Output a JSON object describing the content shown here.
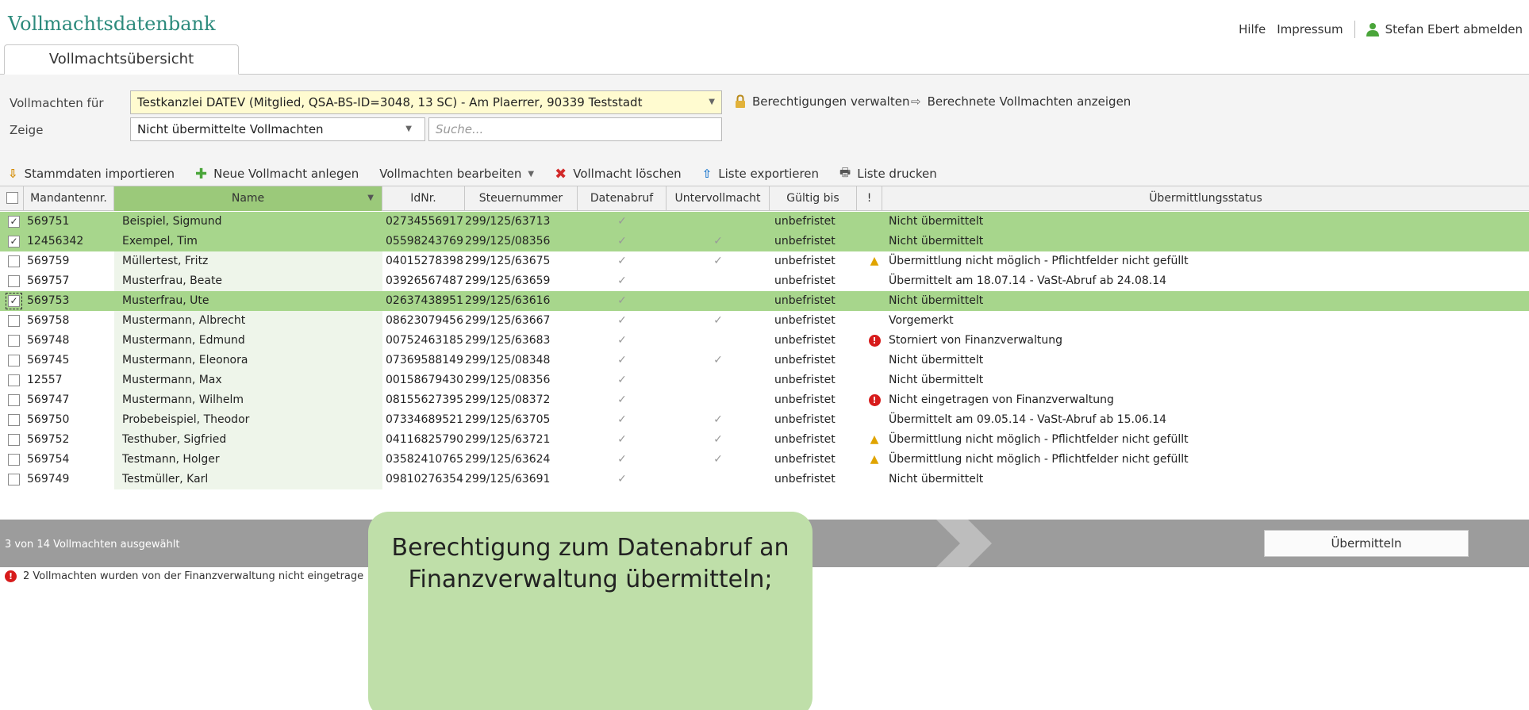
{
  "app": {
    "title": "Vollmachtsdatenbank"
  },
  "topnav": {
    "help": "Hilfe",
    "imprint": "Impressum",
    "logout": "Stefan Ebert abmelden"
  },
  "tabs": [
    {
      "label": "Vollmachtsübersicht"
    }
  ],
  "filters": {
    "vollmachten_label": "Vollmachten für",
    "vollmachten_value": "Testkanzlei DATEV (Mitglied, QSA-BS-ID=3048, 13 SC) - Am Plaerrer, 90339 Teststadt",
    "zeige_label": "Zeige",
    "zeige_value": "Nicht übermittelte Vollmachten",
    "search_placeholder": "Suche...",
    "permissions_link": "Berechtigungen verwalten",
    "computed_link": "Berechnete Vollmachten anzeigen"
  },
  "toolbar": {
    "import": "Stammdaten importieren",
    "new": "Neue Vollmacht anlegen",
    "edit": "Vollmachten bearbeiten",
    "delete": "Vollmacht löschen",
    "export": "Liste exportieren",
    "print": "Liste drucken"
  },
  "columns": [
    "Mandantennr.",
    "Name",
    "IdNr.",
    "Steuernummer",
    "Datenabruf",
    "Untervollmacht",
    "Gültig bis",
    "!",
    "Übermittlungsstatus"
  ],
  "rows": [
    {
      "nr": "569751",
      "name": "Beispiel, Sigmund",
      "idnr": "02734556917",
      "stnr": "299/125/63713",
      "abruf": "✓",
      "unter": "",
      "gueltig": "unbefristet",
      "flag": "",
      "status": "Nicht übermittelt",
      "selected": true
    },
    {
      "nr": "12456342",
      "name": "Exempel, Tim",
      "idnr": "05598243769",
      "stnr": "299/125/08356",
      "abruf": "✓",
      "unter": "✓",
      "gueltig": "unbefristet",
      "flag": "",
      "status": "Nicht übermittelt",
      "selected": true
    },
    {
      "nr": "569759",
      "name": "Müllertest, Fritz",
      "idnr": "04015278398",
      "stnr": "299/125/63675",
      "abruf": "✓",
      "unter": "✓",
      "gueltig": "unbefristet",
      "flag": "warning",
      "status": "Übermittlung nicht möglich - Pflichtfelder nicht gefüllt",
      "selected": false
    },
    {
      "nr": "569757",
      "name": "Musterfrau, Beate",
      "idnr": "03926567487",
      "stnr": "299/125/63659",
      "abruf": "✓",
      "unter": "",
      "gueltig": "unbefristet",
      "flag": "",
      "status": "Übermittelt am 18.07.14 - VaSt-Abruf ab 24.08.14",
      "selected": false
    },
    {
      "nr": "569753",
      "name": "Musterfrau, Ute",
      "idnr": "02637438951",
      "stnr": "299/125/63616",
      "abruf": "✓",
      "unter": "",
      "gueltig": "unbefristet",
      "flag": "",
      "status": "Nicht übermittelt",
      "selected": true
    },
    {
      "nr": "569758",
      "name": "Mustermann, Albrecht",
      "idnr": "08623079456",
      "stnr": "299/125/63667",
      "abruf": "✓",
      "unter": "✓",
      "gueltig": "unbefristet",
      "flag": "",
      "status": "Vorgemerkt",
      "selected": false
    },
    {
      "nr": "569748",
      "name": "Mustermann, Edmund",
      "idnr": "00752463185",
      "stnr": "299/125/63683",
      "abruf": "✓",
      "unter": "",
      "gueltig": "unbefristet",
      "flag": "error",
      "status": "Storniert von Finanzverwaltung",
      "selected": false
    },
    {
      "nr": "569745",
      "name": "Mustermann, Eleonora",
      "idnr": "07369588149",
      "stnr": "299/125/08348",
      "abruf": "✓",
      "unter": "✓",
      "gueltig": "unbefristet",
      "flag": "",
      "status": "Nicht übermittelt",
      "selected": false
    },
    {
      "nr": "12557",
      "name": "Mustermann, Max",
      "idnr": "00158679430",
      "stnr": "299/125/08356",
      "abruf": "✓",
      "unter": "",
      "gueltig": "unbefristet",
      "flag": "",
      "status": "Nicht übermittelt",
      "selected": false
    },
    {
      "nr": "569747",
      "name": "Mustermann, Wilhelm",
      "idnr": "08155627395",
      "stnr": "299/125/08372",
      "abruf": "✓",
      "unter": "",
      "gueltig": "unbefristet",
      "flag": "error",
      "status": "Nicht eingetragen von Finanzverwaltung",
      "selected": false
    },
    {
      "nr": "569750",
      "name": "Probebeispiel, Theodor",
      "idnr": "07334689521",
      "stnr": "299/125/63705",
      "abruf": "✓",
      "unter": "✓",
      "gueltig": "unbefristet",
      "flag": "",
      "status": "Übermittelt am 09.05.14 - VaSt-Abruf ab 15.06.14",
      "selected": false
    },
    {
      "nr": "569752",
      "name": "Testhuber, Sigfried",
      "idnr": "04116825790",
      "stnr": "299/125/63721",
      "abruf": "✓",
      "unter": "✓",
      "gueltig": "unbefristet",
      "flag": "warning",
      "status": "Übermittlung nicht möglich - Pflichtfelder nicht gefüllt",
      "selected": false
    },
    {
      "nr": "569754",
      "name": "Testmann, Holger",
      "idnr": "03582410765",
      "stnr": "299/125/63624",
      "abruf": "✓",
      "unter": "✓",
      "gueltig": "unbefristet",
      "flag": "warning",
      "status": "Übermittlung nicht möglich - Pflichtfelder nicht gefüllt",
      "selected": false
    },
    {
      "nr": "569749",
      "name": "Testmüller, Karl",
      "idnr": "09810276354",
      "stnr": "299/125/63691",
      "abruf": "✓",
      "unter": "",
      "gueltig": "unbefristet",
      "flag": "",
      "status": "Nicht übermittelt",
      "selected": false
    }
  ],
  "footer": {
    "selection_count": "3 von 14 Vollmachten ausgewählt",
    "submit": "Übermitteln"
  },
  "message": {
    "text": "2 Vollmachten wurden von der Finanzverwaltung nicht eingetrage"
  },
  "callout": {
    "line1": "Berechtigung zum Datenabruf an",
    "line2": "Finanzverwaltung übermitteln;"
  },
  "colors": {
    "accent": "#2c8a7c",
    "selected_row": "#a7d68c",
    "warning": "#e0a400",
    "error": "#d71b1b"
  }
}
